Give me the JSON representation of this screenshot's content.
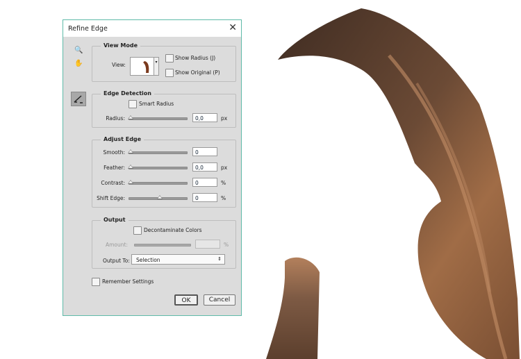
{
  "dialog": {
    "title": "Refine Edge",
    "close": "✕"
  },
  "tools": {
    "zoom": "🔍",
    "hand": "✋"
  },
  "view_mode": {
    "label": "View Mode",
    "view_label": "View:",
    "show_radius": "Show Radius (J)",
    "show_original": "Show Original (P)",
    "show_radius_checked": false,
    "show_original_checked": false
  },
  "edge_detection": {
    "label": "Edge Detection",
    "smart_radius": "Smart Radius",
    "smart_radius_checked": false,
    "radius_label": "Radius:",
    "radius_value": "0,0",
    "radius_unit": "px",
    "radius_slider": 0
  },
  "adjust_edge": {
    "label": "Adjust Edge",
    "rows": [
      {
        "label": "Smooth:",
        "value": "0",
        "unit": "",
        "slider": 0
      },
      {
        "label": "Feather:",
        "value": "0,0",
        "unit": "px",
        "slider": 0
      },
      {
        "label": "Contrast:",
        "value": "0",
        "unit": "%",
        "slider": 0
      },
      {
        "label": "Shift Edge:",
        "value": "0",
        "unit": "%",
        "slider": 0.5
      }
    ]
  },
  "output": {
    "label": "Output",
    "decontaminate": "Decontaminate Colors",
    "decontaminate_checked": false,
    "amount_label": "Amount:",
    "amount_value": "",
    "amount_unit": "%",
    "output_to_label": "Output To:",
    "output_to_value": "Selection",
    "select_arrows": "⇕"
  },
  "remember": {
    "label": "Remember Settings",
    "checked": false
  },
  "buttons": {
    "ok": "OK",
    "cancel": "Cancel"
  },
  "colors": {
    "accent": "#5ebaa8",
    "panel": "#dcdcdc",
    "hair_dark": "#4a3326",
    "hair_light": "#b07a52"
  }
}
